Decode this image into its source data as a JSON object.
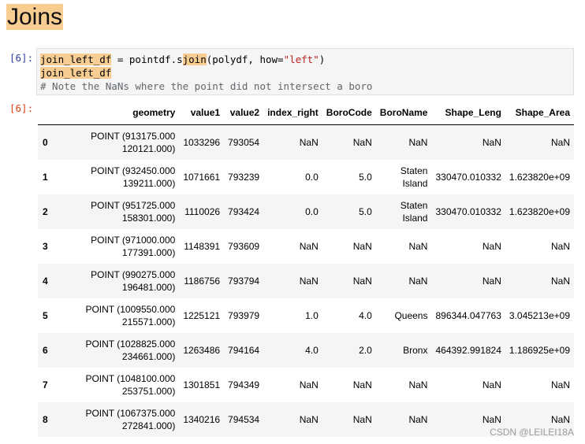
{
  "heading": "Joins",
  "cell": {
    "in_prompt": "[6]:",
    "out_prompt": "[6]:",
    "code": {
      "l1_var": "join_left_df",
      "l1_eq": " = pointdf.s",
      "l1_fn": "join",
      "l1_args": "(polydf, how=",
      "l1_str": "\"left\"",
      "l1_end": ")",
      "l2": "join_left_df",
      "l3_comment": "# Note the NaNs where the point did not intersect a boro"
    }
  },
  "table": {
    "columns": [
      "",
      "geometry",
      "value1",
      "value2",
      "index_right",
      "BoroCode",
      "BoroName",
      "Shape_Leng",
      "Shape_Area"
    ],
    "rows": [
      [
        "0",
        "POINT (913175.000 120121.000)",
        "1033296",
        "793054",
        "NaN",
        "NaN",
        "NaN",
        "NaN",
        "NaN"
      ],
      [
        "1",
        "POINT (932450.000 139211.000)",
        "1071661",
        "793239",
        "0.0",
        "5.0",
        "Staten Island",
        "330470.010332",
        "1.623820e+09"
      ],
      [
        "2",
        "POINT (951725.000 158301.000)",
        "1110026",
        "793424",
        "0.0",
        "5.0",
        "Staten Island",
        "330470.010332",
        "1.623820e+09"
      ],
      [
        "3",
        "POINT (971000.000 177391.000)",
        "1148391",
        "793609",
        "NaN",
        "NaN",
        "NaN",
        "NaN",
        "NaN"
      ],
      [
        "4",
        "POINT (990275.000 196481.000)",
        "1186756",
        "793794",
        "NaN",
        "NaN",
        "NaN",
        "NaN",
        "NaN"
      ],
      [
        "5",
        "POINT (1009550.000 215571.000)",
        "1225121",
        "793979",
        "1.0",
        "4.0",
        "Queens",
        "896344.047763",
        "3.045213e+09"
      ],
      [
        "6",
        "POINT (1028825.000 234661.000)",
        "1263486",
        "794164",
        "4.0",
        "2.0",
        "Bronx",
        "464392.991824",
        "1.186925e+09"
      ],
      [
        "7",
        "POINT (1048100.000 253751.000)",
        "1301851",
        "794349",
        "NaN",
        "NaN",
        "NaN",
        "NaN",
        "NaN"
      ],
      [
        "8",
        "POINT (1067375.000 272841.000)",
        "1340216",
        "794534",
        "NaN",
        "NaN",
        "NaN",
        "NaN",
        "NaN"
      ]
    ]
  },
  "watermark": "CSDN @LEILEI18A"
}
